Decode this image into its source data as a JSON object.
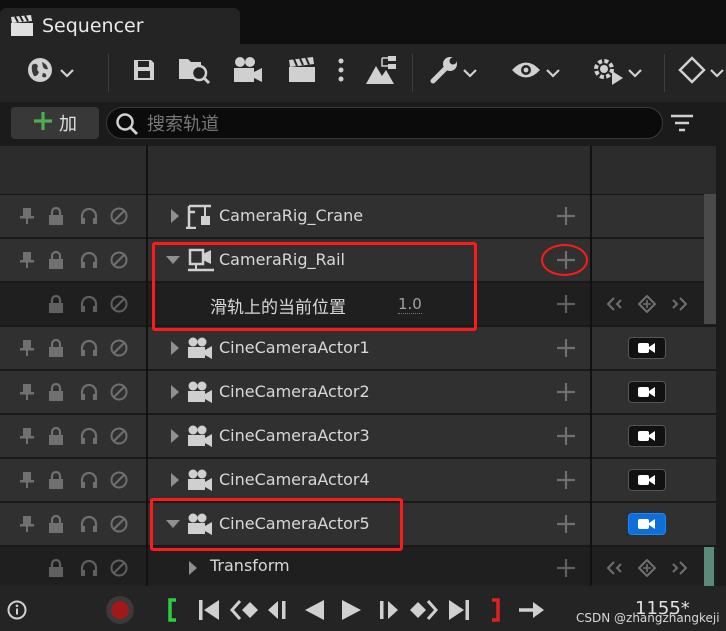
{
  "window": {
    "title": "Sequencer"
  },
  "toolbar": {
    "icons": [
      "world-icon",
      "save-icon",
      "find-asset-icon",
      "camera-icon",
      "clapperboard-icon",
      "more-icon",
      "render-icon",
      "wrench-icon",
      "eye-icon",
      "gear-play-icon",
      "keyframe-icon"
    ]
  },
  "add_button": {
    "label": "加"
  },
  "search": {
    "placeholder": "搜索轨道",
    "value": ""
  },
  "right_edge_digit": "5",
  "tracks": [
    {
      "type": "track",
      "label": "CameraRig_Crane",
      "expanded": false,
      "icon": "camera-crane-icon",
      "key_button": false
    },
    {
      "type": "track",
      "label": "CameraRig_Rail",
      "expanded": true,
      "icon": "camera-rail-icon",
      "key_button": false
    },
    {
      "type": "property",
      "label": "滑轨上的当前位置",
      "value": "1.0"
    },
    {
      "type": "track",
      "label": "CineCameraActor1",
      "expanded": false,
      "icon": "cine-camera-icon",
      "key_button": true,
      "active": false
    },
    {
      "type": "track",
      "label": "CineCameraActor2",
      "expanded": false,
      "icon": "cine-camera-icon",
      "key_button": true,
      "active": false
    },
    {
      "type": "track",
      "label": "CineCameraActor3",
      "expanded": false,
      "icon": "cine-camera-icon",
      "key_button": true,
      "active": false
    },
    {
      "type": "track",
      "label": "CineCameraActor4",
      "expanded": false,
      "icon": "cine-camera-icon",
      "key_button": true,
      "active": false
    },
    {
      "type": "track",
      "label": "CineCameraActor5",
      "expanded": true,
      "icon": "cine-camera-icon",
      "key_button": true,
      "active": true
    },
    {
      "type": "subtrack",
      "label": "Transform"
    }
  ],
  "bottom": {
    "frame": "1155*",
    "watermark": "CSDN @zhangzhangkeji"
  },
  "colors": {
    "accent": "#0f6fd8",
    "highlight": "#ff1a1a",
    "add_green": "#4caf50"
  }
}
